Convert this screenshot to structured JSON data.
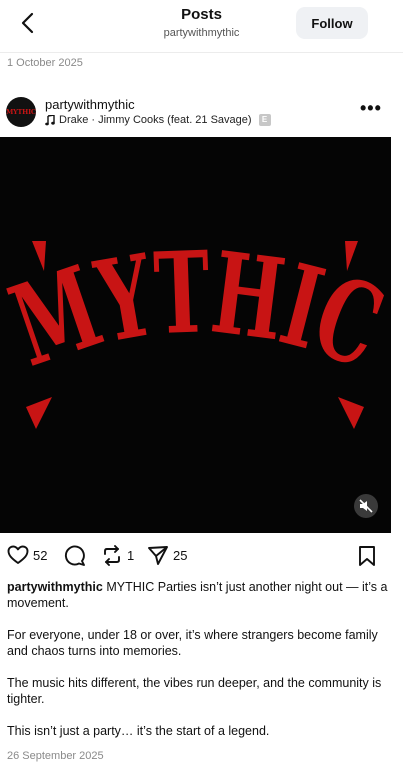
{
  "header": {
    "title": "Posts",
    "subtitle": "partywithmythic",
    "follow_label": "Follow"
  },
  "top_date": "1 October 2025",
  "post": {
    "avatar_text": "MYTHIC",
    "username": "partywithmythic",
    "music": "Drake · Jimmy Cooks (feat. 21 Savage)",
    "explicit_badge": "E",
    "media_logo_text": "MYTHIC",
    "colors": {
      "media_bg": "#050505",
      "logo_red": "#c81414"
    },
    "actions": {
      "likes": "52",
      "reposts": "1",
      "shares": "25"
    },
    "caption": {
      "username": "partywithmythic",
      "line1": "MYTHIC Parties isn’t just another night out — it’s a movement.",
      "para2": "For everyone, under 18 or over, it’s where strangers become family and chaos turns into memories.",
      "para3": "The music hits different, the vibes run deeper, and the community is tighter.",
      "para4": "This isn’t just a party… it’s the start of a legend."
    },
    "date": "26 September 2025"
  }
}
